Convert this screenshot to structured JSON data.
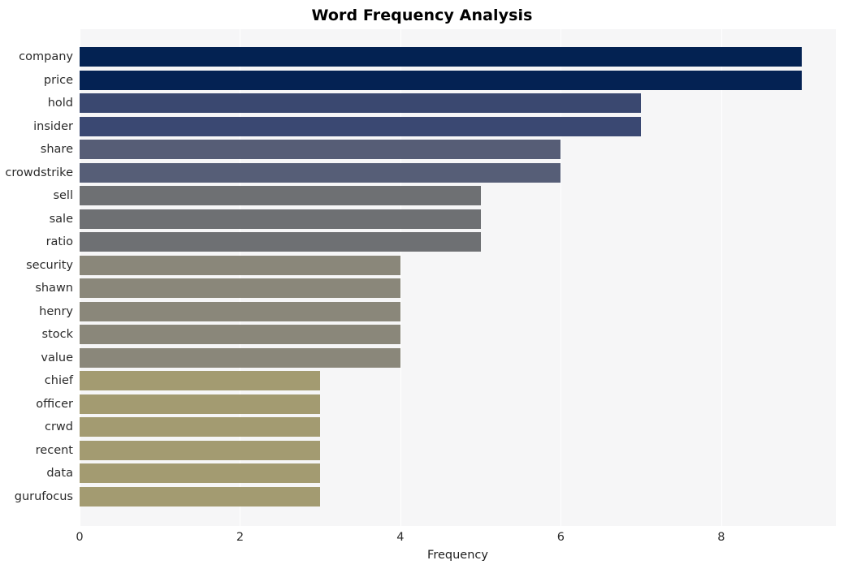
{
  "chart_data": {
    "type": "bar",
    "orientation": "horizontal",
    "title": "Word Frequency Analysis",
    "xlabel": "Frequency",
    "ylabel": "",
    "categories": [
      "company",
      "price",
      "hold",
      "insider",
      "share",
      "crowdstrike",
      "sell",
      "sale",
      "ratio",
      "security",
      "shawn",
      "henry",
      "stock",
      "value",
      "chief",
      "officer",
      "crwd",
      "recent",
      "data",
      "gurufocus"
    ],
    "values": [
      9,
      9,
      7,
      7,
      6,
      6,
      5,
      5,
      5,
      4,
      4,
      4,
      4,
      4,
      3,
      3,
      3,
      3,
      3,
      3
    ],
    "bar_colors": [
      "#032252",
      "#042253",
      "#3a4870",
      "#3a4872",
      "#565d76",
      "#565e77",
      "#6e7073",
      "#6e7073",
      "#6e7073",
      "#8a877a",
      "#8a877a",
      "#8a877a",
      "#8a877a",
      "#8a877a",
      "#a39b71",
      "#a39b71",
      "#a39b71",
      "#a39b71",
      "#a39b71",
      "#a39b71"
    ],
    "xticks": [
      0,
      2,
      4,
      6,
      8
    ],
    "xtick_labels": [
      "0",
      "2",
      "4",
      "6",
      "8"
    ],
    "xlim": [
      0,
      9.43
    ],
    "ylim_categories": 20,
    "grid": true,
    "grid_axis": "x",
    "legend": null,
    "plot_background": "#f6f6f7",
    "figure_background": "#ffffff",
    "title_color": "#000000",
    "tick_label_color": "#2b2b2b"
  }
}
